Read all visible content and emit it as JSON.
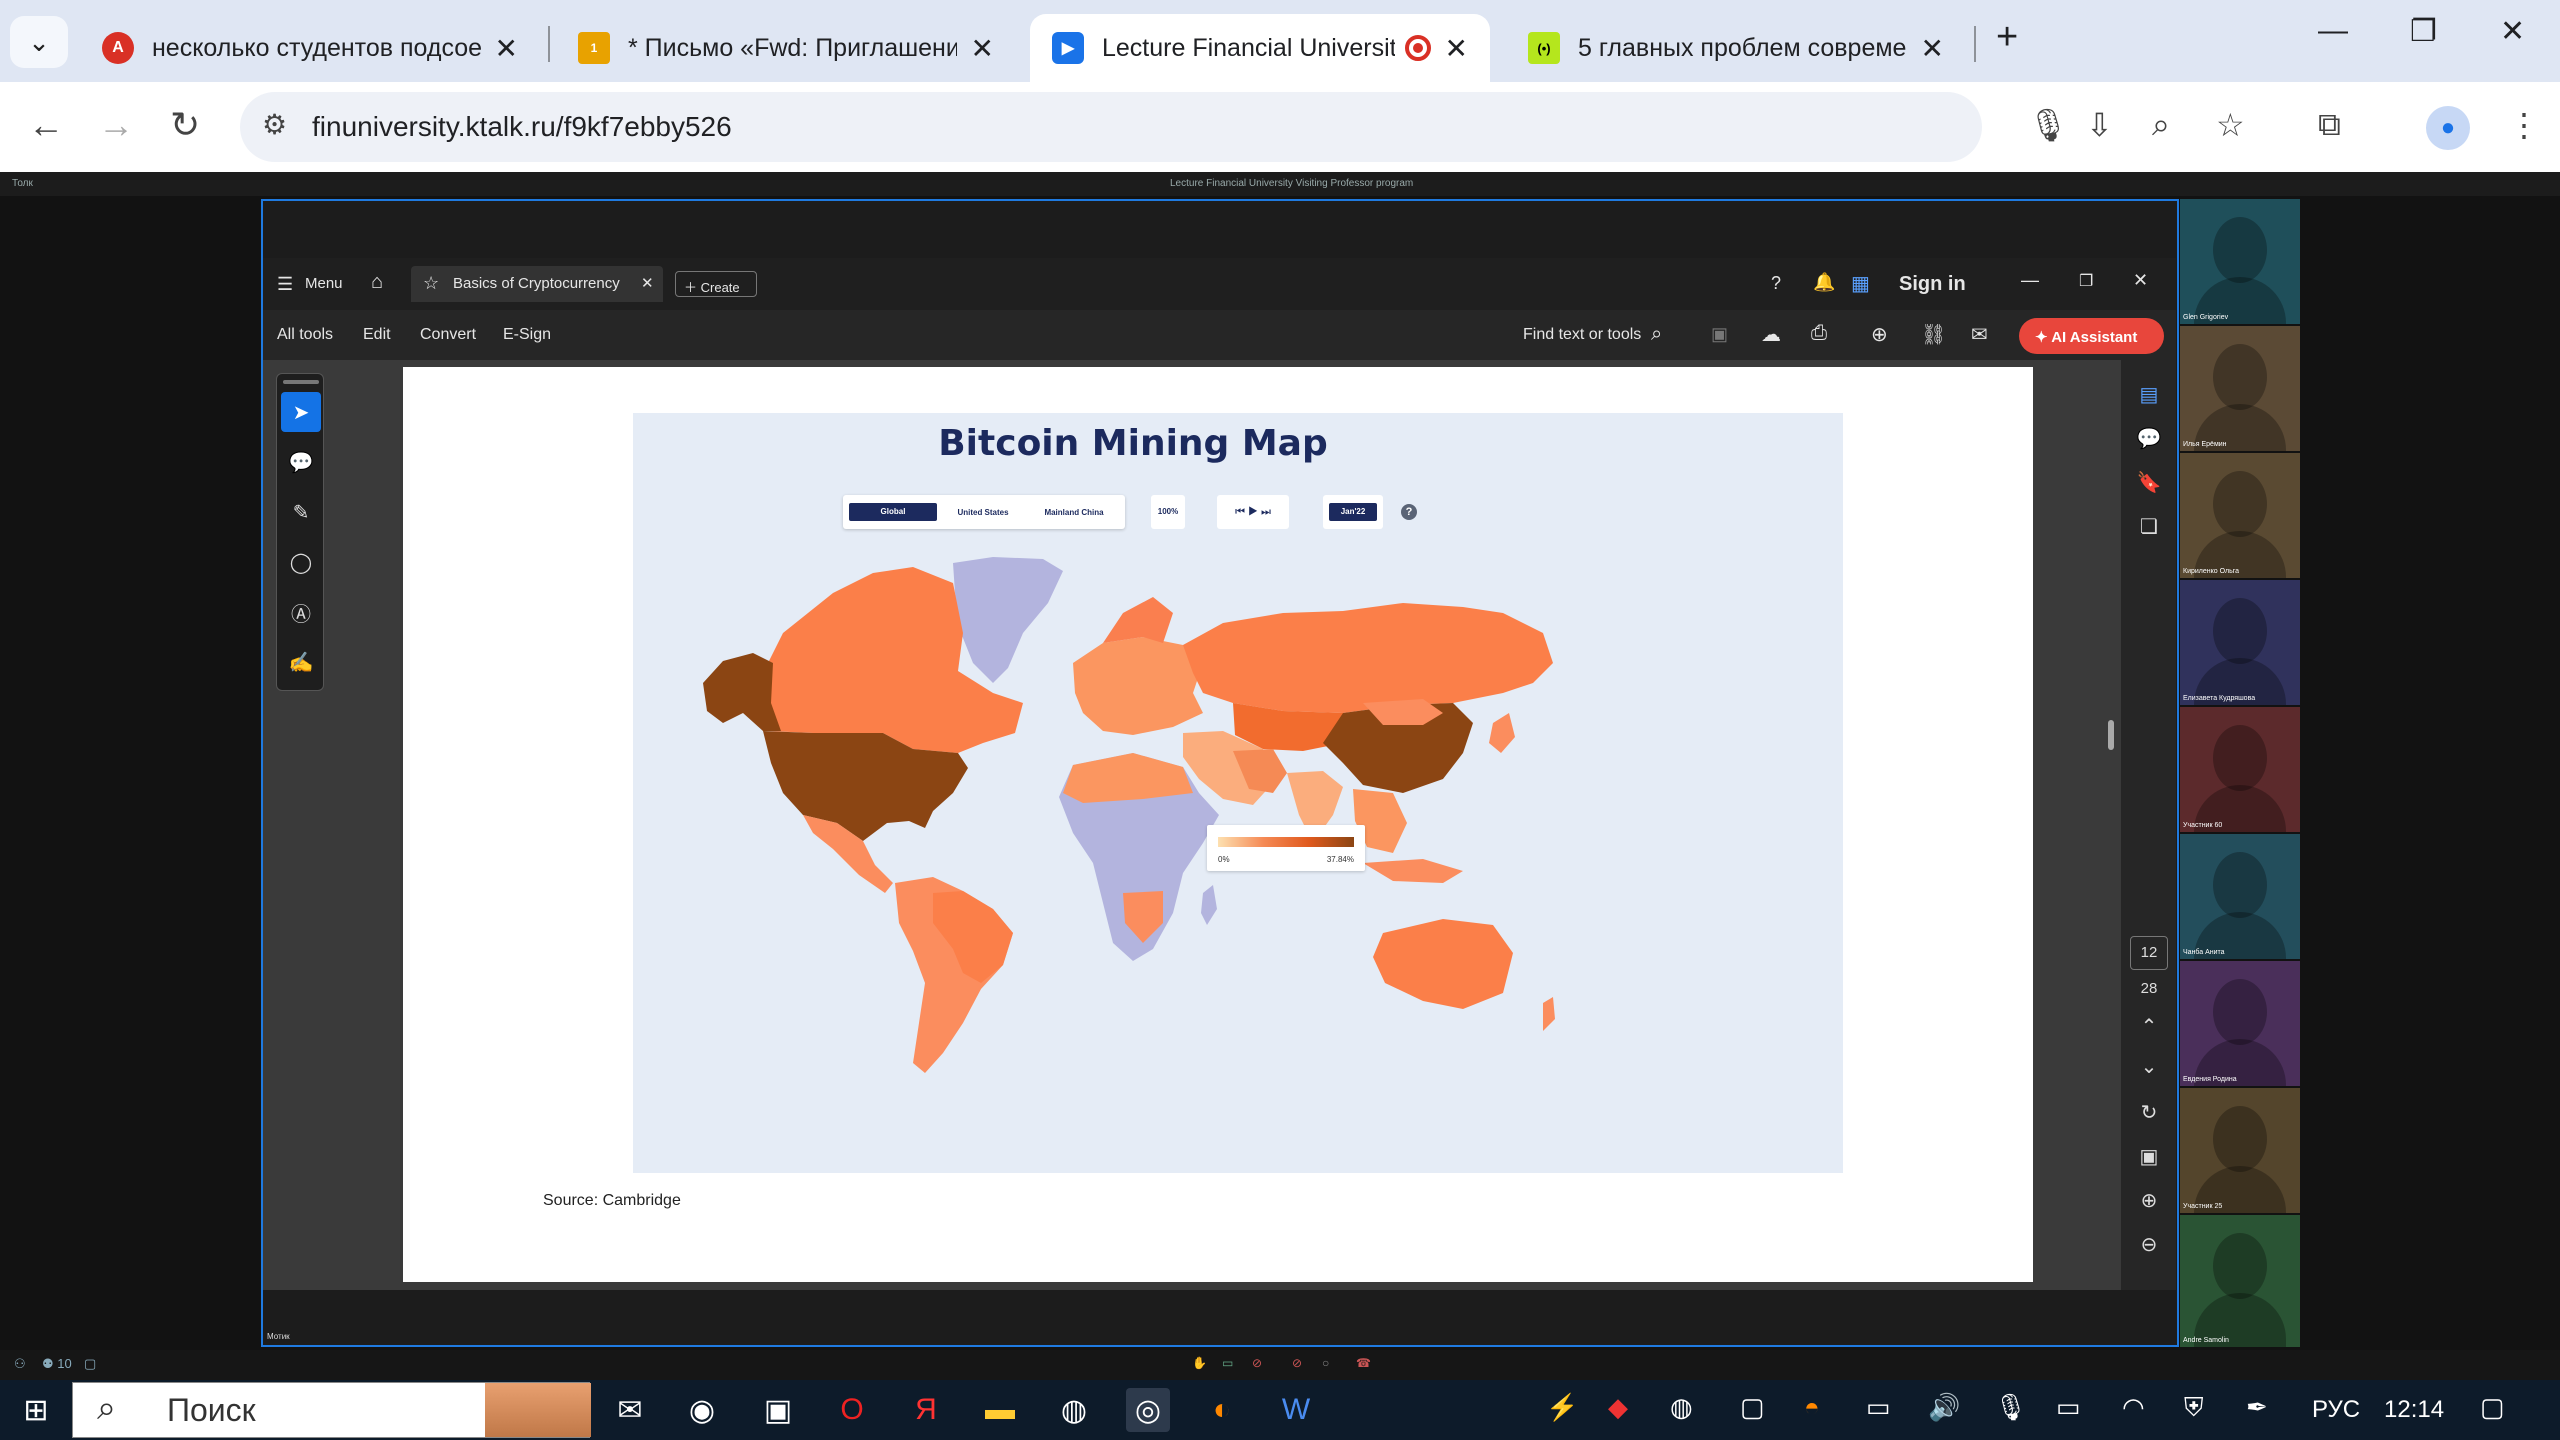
{
  "browser": {
    "tabs": [
      {
        "title": "несколько студентов подсоед",
        "favicon": "translate-icon",
        "color": "#d93025"
      },
      {
        "title": "* Письмо «Fwd: Приглашение",
        "favicon": "mail-icon",
        "color": "#e8a200",
        "badge": "1"
      },
      {
        "title": "Lecture Financial University",
        "favicon": "video-icon",
        "color": "#1a73e8",
        "active": true
      },
      {
        "title": "5 главных проблем современ",
        "favicon": "signal-icon",
        "color": "#b5e61d"
      }
    ],
    "new_tab": "+",
    "url": "finuniversity.ktalk.ru/f9kf7ebby526"
  },
  "meeting": {
    "header": "Lecture Financial University Visiting Professor program",
    "top_left": "Толк",
    "presenter_label": "Мотик",
    "participant_count": "10",
    "participants": [
      {
        "name": "Glen Grigoriev",
        "color": "#1f4f5a"
      },
      {
        "name": "Илья Ерёмин",
        "color": "#5b4a35"
      },
      {
        "name": "Кириленко Ольга",
        "color": "#5a4a32"
      },
      {
        "name": "Елизавета Кудряшова",
        "color": "#30325c"
      },
      {
        "name": "Участник 60",
        "color": "#5c2a2c"
      },
      {
        "name": "Чанба Анита",
        "color": "#234e5c"
      },
      {
        "name": "Евдения Родина",
        "color": "#4a2f5a"
      },
      {
        "name": "Участник 25",
        "color": "#54452c"
      },
      {
        "name": "Andre Samolin",
        "color": "#2a5434"
      }
    ]
  },
  "acrobat": {
    "menu": "Menu",
    "doc_tab": "Basics of Cryptocurrency",
    "create": "Create",
    "sign_in": "Sign in",
    "menu_items": [
      "All tools",
      "Edit",
      "Convert",
      "E-Sign"
    ],
    "find": "Find text or tools",
    "ai_assistant": "AI Assistant",
    "page_current": "12",
    "page_total": "28"
  },
  "slide": {
    "title": "Bitcoin Mining Map",
    "toggle": [
      "Global",
      "United States",
      "Mainland China"
    ],
    "zoom": "100%",
    "date": "Jan'22",
    "legend_min": "0%",
    "legend_max": "37.84%",
    "source": "Source: Cambridge"
  },
  "taskbar": {
    "search": "Поиск",
    "lang": "РУС",
    "time": "12:14"
  }
}
